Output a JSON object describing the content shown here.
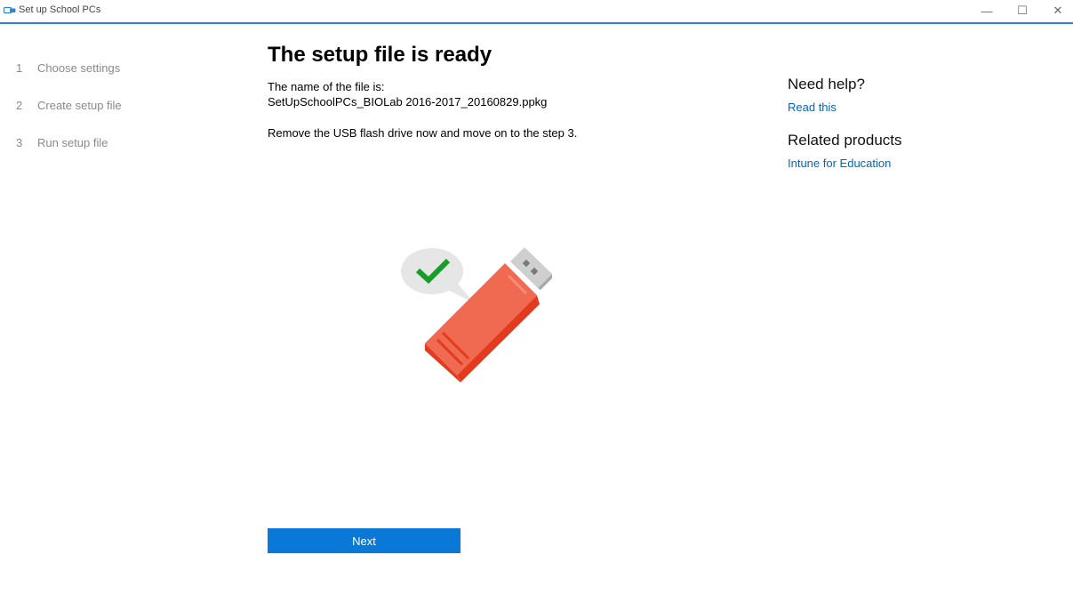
{
  "window": {
    "title": "Set up School PCs",
    "controls": {
      "minimize": "—",
      "maximize": "☐",
      "close": "✕"
    }
  },
  "steps": [
    {
      "number": "1",
      "label": "Choose settings"
    },
    {
      "number": "2",
      "label": "Create setup file"
    },
    {
      "number": "3",
      "label": "Run setup file"
    }
  ],
  "main": {
    "heading": "The setup file is ready",
    "file_label": "The name of the file is:",
    "file_name": "SetUpSchoolPCs_BIOLab 2016-2017_20160829.ppkg",
    "instruction": "Remove the USB flash drive now and move on to the step 3.",
    "next_label": "Next"
  },
  "help": {
    "heading": "Need help?",
    "link": "Read this",
    "related_heading": "Related products",
    "related_link": "Intune for Education"
  },
  "icons": {
    "app": "app-icon",
    "illustration": "usb-drive-check-icon"
  },
  "colors": {
    "accent": "#0a78d7",
    "link": "#0067c0",
    "usb_body": "#ef6a50",
    "check": "#1a9c2a"
  }
}
